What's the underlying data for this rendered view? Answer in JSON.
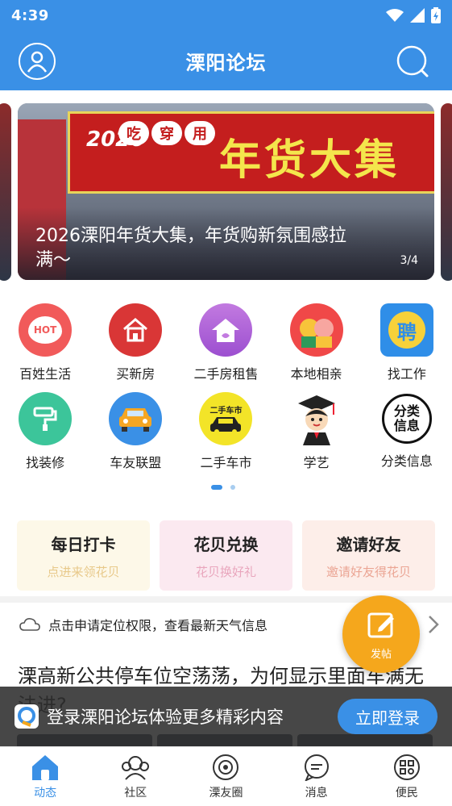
{
  "status": {
    "time": "4:39"
  },
  "header": {
    "title": "溧阳论坛"
  },
  "banner": {
    "caption": "2026溧阳年货大集，年货购新氛围感拉满～",
    "counter": "3/4",
    "arch_text": "年货大集",
    "arch_year": "2026",
    "chip1": "吃",
    "chip2": "穿",
    "chip3": "用"
  },
  "categories": [
    {
      "label": "百姓生活",
      "icon": "hot-icon",
      "color": "#f15a5a"
    },
    {
      "label": "买新房",
      "icon": "house-icon",
      "color": "#d93636"
    },
    {
      "label": "二手房租售",
      "icon": "home-icon",
      "color": "#b764d6"
    },
    {
      "label": "本地相亲",
      "icon": "couple-icon",
      "color": "#f04848"
    },
    {
      "label": "找工作",
      "icon": "job-icon",
      "color": "#2f8ee8"
    },
    {
      "label": "找装修",
      "icon": "roller-icon",
      "color": "#3cc59a"
    },
    {
      "label": "车友联盟",
      "icon": "car-icon",
      "color": "#3a90e6"
    },
    {
      "label": "二手车市",
      "icon": "used-car-icon",
      "color": "#f3e428"
    },
    {
      "label": "学艺",
      "icon": "graduate-icon",
      "color": "#ffffff"
    },
    {
      "label": "分类信息",
      "icon": "classify-icon",
      "color": "#ffffff"
    }
  ],
  "used_car_badge": "二手车市",
  "job_badge": "聘",
  "classify_badge": "分类信息",
  "hot_badge": "HOT",
  "cards": [
    {
      "title": "每日打卡",
      "sub": "点进来领花贝",
      "bg": "#fdf8e8",
      "sub_color": "#e8c98a"
    },
    {
      "title": "花贝兑换",
      "sub": "花贝换好礼",
      "bg": "#fbe9f0",
      "sub_color": "#e9a6bd"
    },
    {
      "title": "邀请好友",
      "sub": "邀请好友得花贝",
      "bg": "#fdeee9",
      "sub_color": "#eba594"
    }
  ],
  "weather": {
    "text": "点击申请定位权限，查看最新天气信息"
  },
  "fab": {
    "label": "发帖"
  },
  "article": {
    "title": "溧高新公共停车位空荡荡，为何显示里面车满无法进?"
  },
  "login": {
    "text": "登录溧阳论坛体验更多精彩内容",
    "button": "立即登录"
  },
  "tabs": [
    {
      "label": "动态",
      "icon": "home-tab-icon",
      "active": true
    },
    {
      "label": "社区",
      "icon": "community-icon",
      "active": false
    },
    {
      "label": "溧友圈",
      "icon": "circle-icon",
      "active": false
    },
    {
      "label": "消息",
      "icon": "message-icon",
      "active": false
    },
    {
      "label": "便民",
      "icon": "service-icon",
      "active": false
    }
  ],
  "colors": {
    "brand": "#3a90e6",
    "fab": "#f5a71c"
  }
}
